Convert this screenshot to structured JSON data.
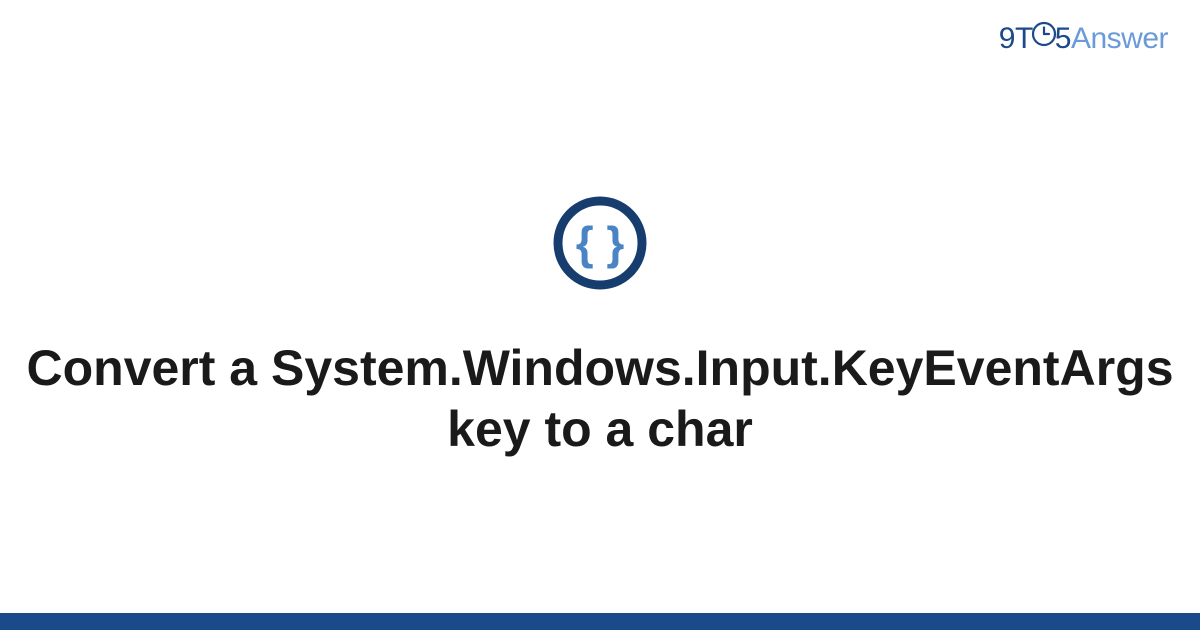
{
  "brand": {
    "part1": "9",
    "part2": "T",
    "part3": "5",
    "part4": "Answer"
  },
  "title": "Convert a System.Windows.Input.KeyEventArgs key to a char",
  "colors": {
    "primary": "#1b4a8a",
    "accent": "#6a9bd8",
    "text": "#1a1a1a"
  },
  "icon": {
    "name": "braces-icon",
    "ring_color": "#163d6e",
    "brace_color": "#4a84c4"
  }
}
